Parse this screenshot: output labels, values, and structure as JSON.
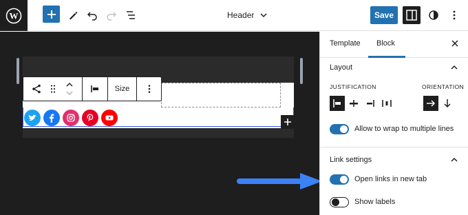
{
  "topbar": {
    "document_title": "Header",
    "save_label": "Save",
    "icons": [
      "wordpress-logo",
      "plus-icon",
      "pen-icon",
      "undo-icon",
      "redo-icon",
      "list-view-icon",
      "chevron-down-icon",
      "sidebar-toggle-icon",
      "contrast-icon",
      "more-vertical-icon"
    ]
  },
  "block_toolbar": {
    "size_label": "Size",
    "icons": [
      "share-icon",
      "drag-handle-icon",
      "move-up-down-icon",
      "justify-left-icon",
      "more-vertical-icon"
    ]
  },
  "social_links": [
    "twitter",
    "facebook",
    "instagram",
    "pinterest",
    "youtube"
  ],
  "social_colors": {
    "twitter": "#1da1f2",
    "facebook": "#1877f2",
    "instagram": "#e1306c",
    "pinterest": "#e60023",
    "youtube": "#ff0000"
  },
  "sidebar": {
    "tabs": [
      "Template",
      "Block"
    ],
    "active_tab": "Block",
    "layout": {
      "title": "Layout",
      "justification_label": "JUSTIFICATION",
      "orientation_label": "ORIENTATION",
      "justification_options": [
        "justify-left-icon",
        "justify-center-icon",
        "justify-right-icon",
        "justify-space-between-icon"
      ],
      "justification_selected": "justify-left-icon",
      "orientation_options": [
        "arrow-right-icon",
        "arrow-down-icon"
      ],
      "orientation_selected": "arrow-right-icon",
      "wrap_label": "Allow to wrap to multiple lines",
      "wrap_on": true
    },
    "link_settings": {
      "title": "Link settings",
      "new_tab_label": "Open links in new tab",
      "new_tab_on": true,
      "show_labels_label": "Show labels",
      "show_labels_on": false
    }
  },
  "colors": {
    "accent": "#2271b1",
    "canvas": "#1e1e1e",
    "annotation_arrow": "#3b82f6"
  }
}
